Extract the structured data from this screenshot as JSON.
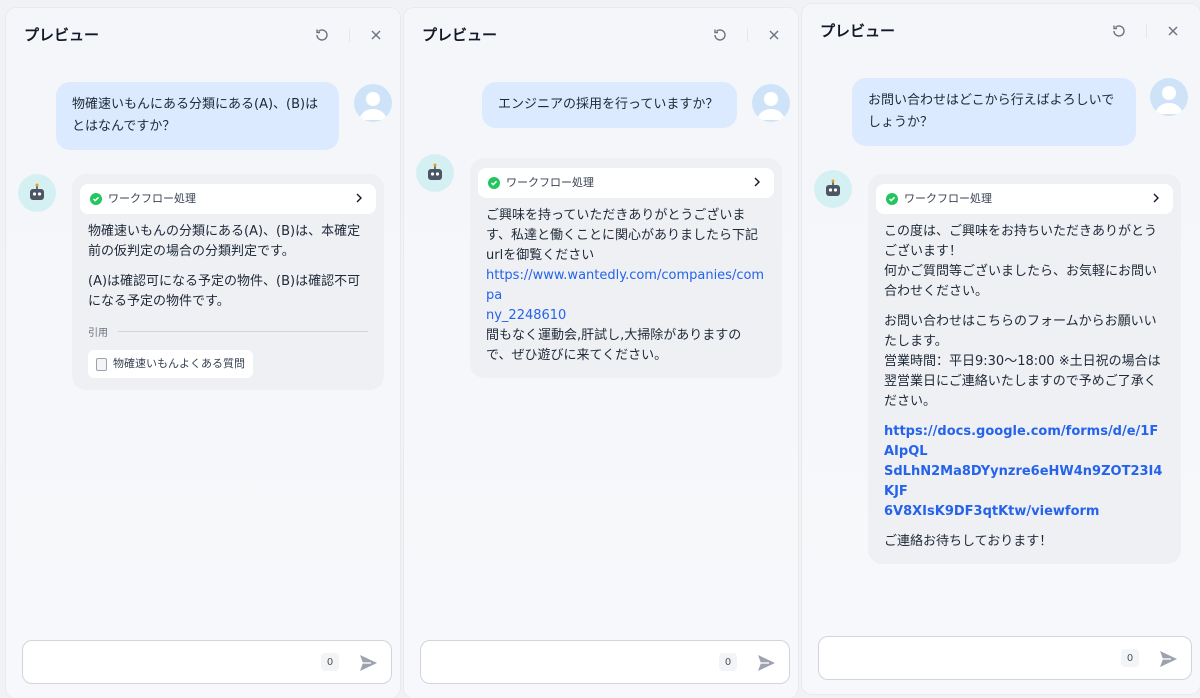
{
  "panels": [
    {
      "title": "プレビュー",
      "user_message": [
        "物確速いもんにある分類にある(A)、(B)は",
        "とはなんですか？"
      ],
      "workflow_label": "ワークフロー処理",
      "bot_paragraphs": [
        [
          "物確速いもんの分類にある(A)、(B)は、本確定",
          "前の仮判定の場合の分類判定です。"
        ],
        [
          "(A)は確認可になる予定の物件、(B)は確認不可",
          "になる予定の物件です。"
        ]
      ],
      "citation_label": "引用",
      "citation_item": "物確速いもんよくある質問",
      "input_count": "0"
    },
    {
      "title": "プレビュー",
      "user_message": [
        "エンジニアの採用を行っていますか？"
      ],
      "workflow_label": "ワークフロー処理",
      "bot_lines_before_link": [
        "ご興味を持っていただきありがとうございま",
        "す、私達と働くことに関心がありましたら下記",
        "urlを御覧ください"
      ],
      "bot_link_lines": [
        "https://www.wantedly.com/companies/compa",
        "ny_2248610"
      ],
      "bot_lines_after_link": [
        "間もなく運動会,肝試し,大掃除がありますの",
        "で、ぜひ遊びに来てください。"
      ],
      "input_count": "0"
    },
    {
      "title": "プレビュー",
      "user_message": [
        "お問い合わせはどこから行えばよろしいで",
        "しょうか？"
      ],
      "workflow_label": "ワークフロー処理",
      "bot_block1": [
        "この度は、ご興味をお持ちいただきありがとう",
        "ございます！",
        "何かご質問等ございましたら、お気軽にお問い",
        "合わせください。"
      ],
      "bot_block2": [
        "お問い合わせはこちらのフォームからお願いい",
        "たします。",
        "営業時間：平日9:30〜18:00 ※土日祝の場合は",
        "翌営業日にご連絡いたしますので予めご了承く",
        "ださい。"
      ],
      "bot_link_lines": [
        "https://docs.google.com/forms/d/e/1FAIpQL",
        "SdLhN2Ma8DYynzre6eHW4n9ZOT23I4KJF",
        "6V8XIsK9DF3qtKtw/viewform"
      ],
      "bot_closing": "ご連絡お待ちしております！",
      "input_count": "0"
    }
  ],
  "icons": {
    "reload": "reload-icon",
    "close": "close-icon",
    "user_avatar": "user-avatar-icon",
    "bot_avatar": "robot-icon",
    "check": "check-circle-icon",
    "chevron": "chevron-right-icon",
    "send": "send-icon",
    "document": "document-icon"
  },
  "colors": {
    "user_bubble": "#dbeafe",
    "bot_bubble": "#eef0f4",
    "link": "#2563eb",
    "success": "#22c55e"
  }
}
